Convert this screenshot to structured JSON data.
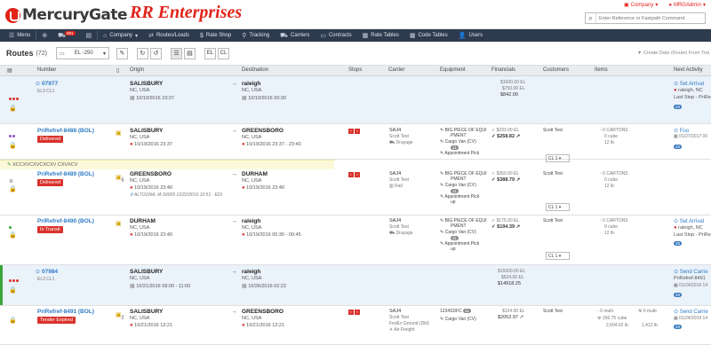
{
  "header": {
    "logo_text": "MercuryGate",
    "company_name": "RR Enterprises",
    "company_link": "Company",
    "user_link": "MRGAdmin",
    "search_placeholder": "Enter Reference or Fastpath Command"
  },
  "nav": {
    "items": [
      {
        "label": "Menu",
        "icon": "menu-icon"
      },
      {
        "label": "",
        "icon": "plus-icon"
      },
      {
        "label": "",
        "icon": "truck-alert-icon",
        "badge": "881"
      },
      {
        "label": "",
        "icon": "calculator-icon"
      },
      {
        "label": "Company",
        "icon": "company-icon"
      },
      {
        "label": "Routes/Loads",
        "icon": "routes-icon"
      },
      {
        "label": "Rate Shop",
        "icon": "rateshop-icon"
      },
      {
        "label": "Tracking",
        "icon": "pin-icon"
      },
      {
        "label": "Carriers",
        "icon": "truck-icon"
      },
      {
        "label": "Contracts",
        "icon": "contract-icon"
      },
      {
        "label": "Rate Tables",
        "icon": "table-icon"
      },
      {
        "label": "Code Tables",
        "icon": "codetable-icon"
      },
      {
        "label": "Users",
        "icon": "users-icon"
      }
    ]
  },
  "toolbar": {
    "title": "Routes",
    "count": "(72)",
    "filter_value": "EL -250",
    "el_label": "EL",
    "cl_label": "CL",
    "sort_note": "Create Date (Route) From Tod"
  },
  "columns": [
    "Number",
    "Origin",
    "Destination",
    "Stops",
    "Carrier",
    "Equipment",
    "Financials",
    "Customers",
    "Items",
    "Next Activity"
  ],
  "rows": [
    {
      "number": "07977",
      "sub": "EL3 CL1",
      "origin_city": "SALISBURY",
      "origin_state": "NC, USA",
      "origin_date": "10/19/2016 23:37",
      "dest_city": "raleigh",
      "dest_state": "NC, USA",
      "dest_date": "10/19/2016 00:30",
      "fin1": "$1600.00 EL",
      "fin2": "$750.00 EL",
      "fin3": "$842.00",
      "next_title": "Set Arrival",
      "next_line1": "raleigh, NC",
      "next_line2": "Last Stop - PriRe",
      "next_badge": "48"
    },
    {
      "number": "PriRefref-8488 (BOL)",
      "status": "Delivered",
      "origin_city": "SALISBURY",
      "origin_state": "NC, USA",
      "origin_date": "10/19/2016 23:37",
      "dest_city": "GREENSBORO",
      "dest_state": "NC, USA",
      "dest_date": "10/19/2016 23:37 - 23:40",
      "carrier": "SAJ4",
      "carrier_sub": "Scott Test",
      "carrier_mode": "Drayage",
      "equip1": "BIG PIECE OF EQUI",
      "equip1b": "PMENT",
      "equip2": "Cargo Van (CV)",
      "equip2_badge": "11",
      "equip3": "Appointment Pick",
      "equip3b": "up",
      "fin1": "$233.00 EL",
      "fin2": "$258.82",
      "customer": "Scott Test",
      "customer_sel": "CL 1",
      "items1": "0 CARTONS",
      "items2": "0",
      "items2u": "cube",
      "items3": "12",
      "items3u": "lb",
      "next_title": "Foo",
      "next_line1": "01/27/2017 00",
      "next_badge": "48",
      "note": "XCCXVCXVCXCXV CXVXCV"
    },
    {
      "number": "PriRefref-8489 (BOL)",
      "status": "Delivered",
      "stops_num": "5",
      "origin_city": "GREENSBORO",
      "origin_state": "NC, USA",
      "origin_date": "10/19/2016 23:40",
      "origin_extra": "ALTOONA, IA 50009 12/22/2016 10:51",
      "dest_city": "DURHAM",
      "dest_state": "NC, USA",
      "dest_date": "10/19/2016 23:40",
      "carrier": "SAJ4",
      "carrier_sub": "Scott Test",
      "carrier_mode": "Rail",
      "equip1": "BIG PIECE OF EQUI",
      "equip1b": "PMENT",
      "equip2": "Cargo Van (CV)",
      "equip2_badge": "11",
      "equip3": "Appointment Pick",
      "equip3b": "up",
      "fin1": "$350.00 EL",
      "fin2": "$388.79",
      "customer": "Scott Test",
      "customer_sel": "CL 1",
      "items1": "0 CARTONS",
      "items2": "0",
      "items2u": "cube",
      "items3": "12",
      "items3u": "lb"
    },
    {
      "number": "PriRefref-8490 (BOL)",
      "status": "In Transit",
      "origin_city": "DURHAM",
      "origin_state": "NC, USA",
      "origin_date": "10/19/2016 23:40",
      "dest_city": "raleigh",
      "dest_state": "NC, USA",
      "dest_date": "10/19/2016 00:30 - 00:45",
      "carrier": "SAJ4",
      "carrier_sub": "Scott Test",
      "carrier_mode": "Drayage",
      "equip1": "BIG PIECE OF EQUI",
      "equip1b": "PMENT",
      "equip2": "Cargo Van (CV)",
      "equip2_badge": "11",
      "equip3": "Appointment Pick",
      "equip3b": "up",
      "fin1": "$175.00 EL",
      "fin2": "$194.39",
      "customer": "Scott Test",
      "customer_sel": "CL 1",
      "items1": "0 CARTONS",
      "items2": "0",
      "items2u": "cube",
      "items3": "12",
      "items3u": "lb",
      "next_title": "Set Arrival",
      "next_line1": "raleigh, NC",
      "next_line2": "Last Stop - PriRe",
      "next_badge": "48"
    },
    {
      "number": "07984",
      "sub": "EL3 CL1",
      "origin_city": "SALISBURY",
      "origin_state": "NC, USA",
      "origin_date": "10/21/2016 08:00 - 11:00",
      "dest_city": "raleigh",
      "dest_state": "NC, USA",
      "dest_date": "10/26/2016 02:22",
      "fin1": "$15000.00 EL",
      "fin2": "$524.00 EL",
      "fin3": "$14918.25",
      "next_title": "Send Carrie",
      "next_line1": "PriRefref-8491",
      "next_line2": "01/24/2019 14",
      "next_badge": "48"
    },
    {
      "number": "PriRefref-8491 (BOL)",
      "status": "Tender Expired",
      "stops_num": "2",
      "origin_city": "SALISBURY",
      "origin_state": "NC, USA",
      "origin_date": "10/21/2016 13:21",
      "dest_city": "GREENSBORO",
      "dest_state": "NC, USA",
      "dest_date": "10/21/2016 13:21",
      "carrier": "SAJ4",
      "carrier_sub": "Scott Test",
      "carrier_mode": "FedEx Ground (Dld)",
      "carrier_mode2": "Air Freight",
      "equip1": "1234SDFC",
      "equip1_badge": "11",
      "equip2": "Cargo Van (CV)",
      "fin1": "$124.00 EL",
      "fin2": "$2052.97",
      "customer": "Scott Test",
      "items1": "0 multi",
      "items1b": "0 multi",
      "items2": "156.75",
      "items2u": "cube",
      "items3": "2,604.62",
      "items3u": "lb",
      "items4": "1,412",
      "items4u": "lb",
      "next_title": "Send Carrie",
      "next_line1": "01/24/2019 14",
      "next_badge": "48"
    }
  ]
}
